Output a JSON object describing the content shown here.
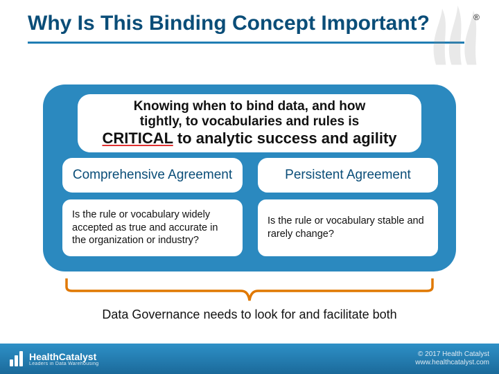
{
  "title": "Why Is This Binding Concept Important?",
  "registered": "®",
  "top_box": {
    "line1": "Knowing when to bind data, and how",
    "line2": "tightly, to vocabularies and rules is",
    "critical": "CRITICAL",
    "rest": " to analytic success and agility"
  },
  "cols": {
    "left_head": "Comprehensive Agreement",
    "left_body": "Is the rule or vocabulary widely accepted as true and accurate in the organization or industry?",
    "right_head": "Persistent Agreement",
    "right_body": "Is the rule or vocabulary stable and rarely change?"
  },
  "bracket_label": "Data Governance needs to look for and facilitate both",
  "footer": {
    "brand": "HealthCatalyst",
    "tagline": "Leaders in Data Warehousing",
    "copyright": "© 2017 Health Catalyst",
    "url": "www.healthcatalyst.com"
  },
  "colors": {
    "accent": "#2b89bf",
    "title": "#0a4d78",
    "bracket": "#e07800"
  }
}
